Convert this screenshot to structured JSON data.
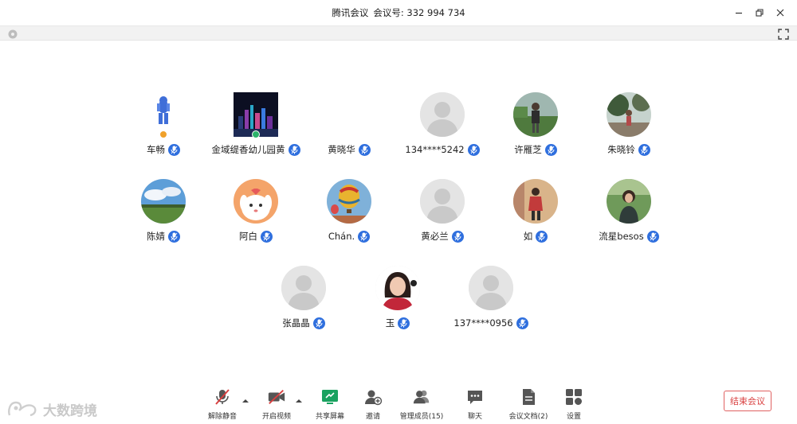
{
  "window": {
    "app_title": "腾讯会议",
    "meeting_id_label": "会议号:",
    "meeting_id": "332 994 734"
  },
  "participants": [
    {
      "name": "车畅",
      "avatar": "figure-avatar",
      "badge": "orange"
    },
    {
      "name": "金域缇香幼儿园黄",
      "avatar": "night-city-avatar",
      "badge": "green"
    },
    {
      "name": "黄晓华",
      "avatar": "none"
    },
    {
      "name": "134****5242",
      "avatar": "default-user-avatar"
    },
    {
      "name": "许雁芝",
      "avatar": "outdoor-photo-avatar"
    },
    {
      "name": "朱晓铃",
      "avatar": "tree-photo-avatar"
    },
    {
      "name": "陈婧",
      "avatar": "sky-field-avatar"
    },
    {
      "name": "阿白",
      "avatar": "cartoon-dog-avatar"
    },
    {
      "name": "Chán.",
      "avatar": "balloon-avatar"
    },
    {
      "name": "黄必兰",
      "avatar": "default-user-avatar"
    },
    {
      "name": "如",
      "avatar": "woman-room-avatar"
    },
    {
      "name": "流星besos",
      "avatar": "woman-outdoor-avatar"
    },
    {
      "name": "张晶晶",
      "avatar": "default-user-avatar"
    },
    {
      "name": "玉",
      "avatar": "woman-portrait-avatar"
    },
    {
      "name": "137****0956",
      "avatar": "default-user-avatar"
    }
  ],
  "toolbar": {
    "unmute": "解除静音",
    "start_video": "开启视频",
    "share_screen": "共享屏幕",
    "invite": "邀请",
    "manage_members": "管理成员(15)",
    "chat": "聊天",
    "docs": "会议文档(2)",
    "settings": "设置",
    "end_meeting": "结束会议"
  },
  "watermark": {
    "text": "大数跨境"
  },
  "colors": {
    "mic_blue": "#2f6fde",
    "end_red": "#d94040",
    "share_green": "#1aa260"
  }
}
